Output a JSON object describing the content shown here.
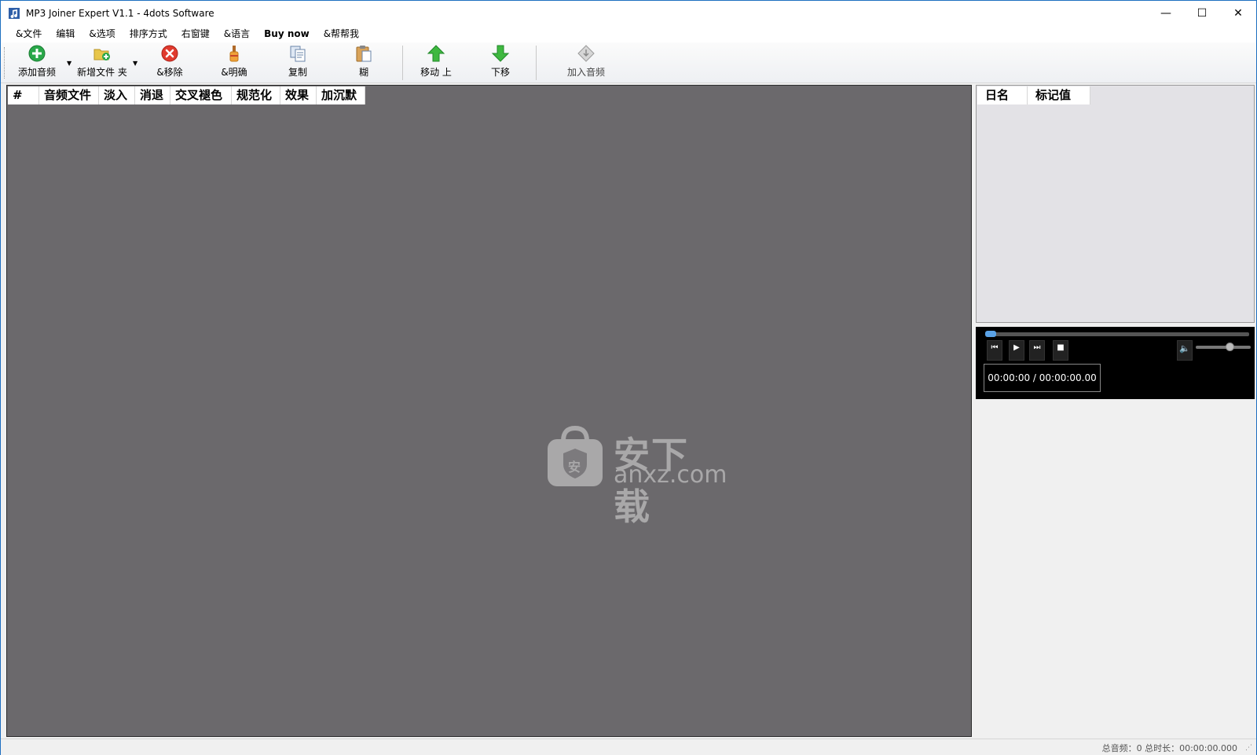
{
  "window": {
    "title": "MP3 Joiner Expert V1.1 - 4dots Software",
    "minimize": "—",
    "maximize": "☐",
    "close": "✕"
  },
  "menu": [
    "&文件",
    "编辑",
    "&选项",
    "排序方式",
    "右窗键",
    "&语言",
    "Buy now",
    "&帮帮我"
  ],
  "toolbar": {
    "add_audio": "添加音频",
    "add_folder": "新增文件 夹",
    "remove": "&移除",
    "clear": "&明确",
    "copy": "复制",
    "paste": "糊",
    "move_up": "移动 上",
    "move_down": "下移",
    "join_audio": "加入音频"
  },
  "columns": [
    "#",
    "音频文件",
    "淡入",
    "消退",
    "交叉褪色",
    "规范化",
    "效果",
    "加沉默"
  ],
  "tag_columns": [
    "日名",
    "标记值"
  ],
  "player": {
    "time": "00:00:00 / 00:00:00.00",
    "seek_position": 0.0,
    "volume": 0.62
  },
  "watermark": {
    "text": "安下载",
    "sub": "anxz.com",
    "badge": "安"
  },
  "status": {
    "text": "总音频：0  总时长：00:00:00.000"
  },
  "colors": {
    "list_bg": "#6b696c",
    "tag_bg": "#e3e2e6",
    "player_bg": "#000000",
    "accent": "#5aa2e6"
  }
}
